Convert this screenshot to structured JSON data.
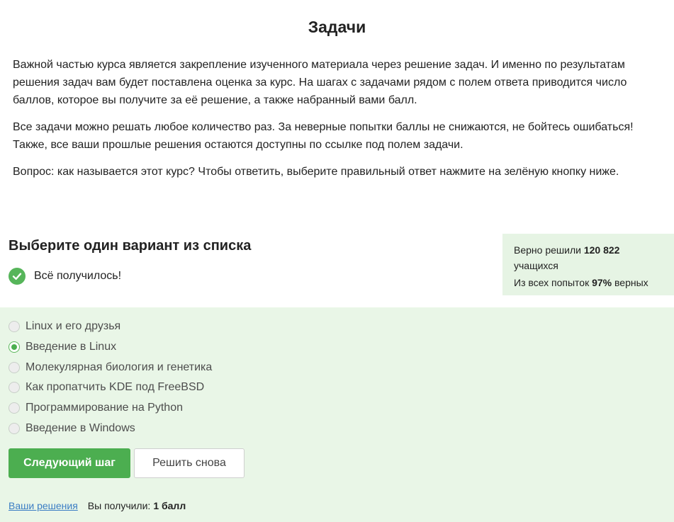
{
  "header": {
    "title": "Задачи"
  },
  "intro": {
    "paragraph1": "Важной частью курса является закрепление изученного материала через решение задач. И именно по результатам решения задач вам будет поставлена оценка за курс. На шагах с задачами рядом с полем ответа приводится число баллов, которое вы получите за её решение, а также набранный вами балл.",
    "paragraph2": "Все задачи можно решать любое количество раз. За неверные попытки баллы не снижаются, не бойтесь ошибаться! Также, все ваши прошлые решения остаются доступны по ссылке под полем задачи.",
    "question": "Вопрос: как называется этот курс? Чтобы ответить, выберите правильный ответ нажмите на зелёную кнопку ниже."
  },
  "quiz": {
    "heading": "Выберите один вариант из списка",
    "success_icon": "check-circle-icon",
    "success_text": "Всё получилось!",
    "options": [
      {
        "label": "Linux и его друзья",
        "selected": false
      },
      {
        "label": "Введение в Linux",
        "selected": true
      },
      {
        "label": "Молекулярная биология и генетика",
        "selected": false
      },
      {
        "label": "Как пропатчить KDE под FreeBSD",
        "selected": false
      },
      {
        "label": "Программирование на Python",
        "selected": false
      },
      {
        "label": "Введение в Windows",
        "selected": false
      }
    ],
    "next_button": "Следующий шаг",
    "retry_button": "Решить снова"
  },
  "stats": {
    "solved_prefix": "Верно решили",
    "solved_count": "120 822",
    "solved_suffix": "учащихся",
    "attempts_prefix": "Из всех попыток",
    "attempts_percent": "97%",
    "attempts_suffix": "верных"
  },
  "footer": {
    "solutions_link": "Ваши решения",
    "score_label": "Вы получили:",
    "score_value": "1 балл"
  },
  "colors": {
    "accent_green": "#4cae50",
    "green_background": "#e9f6e7",
    "stats_background": "#e6f4e4",
    "link_blue": "#3b7dc4"
  }
}
